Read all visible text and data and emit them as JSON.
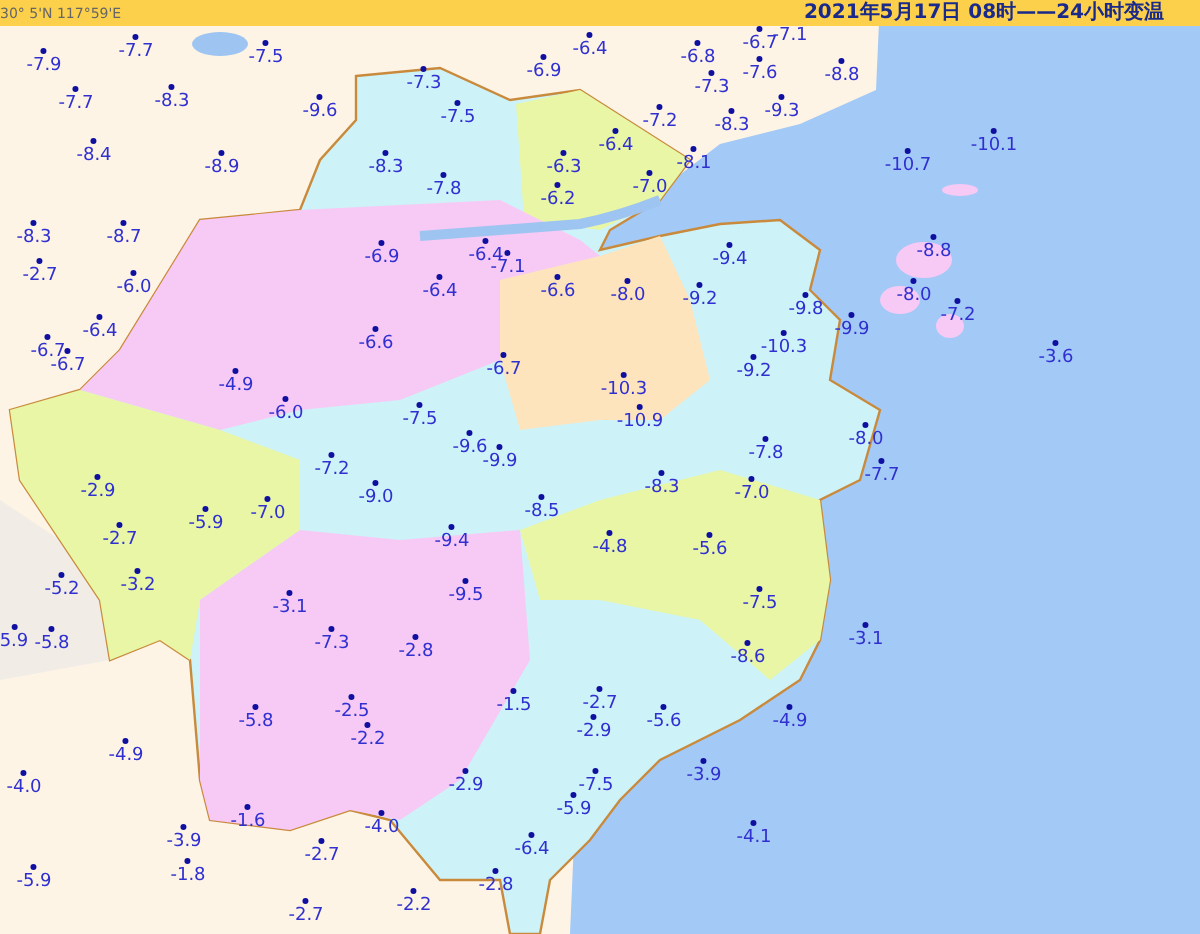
{
  "header": {
    "coordinates": "30° 5'N  117°59'E",
    "title": "2021年5月17日 08时——24小时变温"
  },
  "stations": [
    {
      "reading": "-7.9"
    },
    {
      "reading": "-7.7"
    },
    {
      "reading": "-7.5"
    },
    {
      "reading": "-7.7"
    },
    {
      "reading": "-8.3"
    },
    {
      "reading": "-9.6"
    },
    {
      "reading": "-8.4"
    },
    {
      "reading": "-8.9"
    },
    {
      "reading": "-8.3"
    },
    {
      "reading": "-8.3"
    },
    {
      "reading": "-8.7"
    },
    {
      "reading": "-6.9"
    },
    {
      "reading": "-2.7"
    },
    {
      "reading": "-6.0"
    },
    {
      "reading": "-6.4"
    },
    {
      "reading": "-6.6"
    },
    {
      "reading": "-6.7"
    },
    {
      "reading": "-6.7"
    },
    {
      "reading": "-4.9"
    },
    {
      "reading": "-6.0"
    },
    {
      "reading": "-6.4"
    },
    {
      "reading": "-6.9"
    },
    {
      "reading": "-7.3"
    },
    {
      "reading": "-6.8"
    },
    {
      "reading": "-6.7"
    },
    {
      "reading": "-7.1"
    },
    {
      "reading": "-7.6"
    },
    {
      "reading": "-7.3"
    },
    {
      "reading": "-7.5"
    },
    {
      "reading": "-7.2"
    },
    {
      "reading": "-8.3"
    },
    {
      "reading": "-9.3"
    },
    {
      "reading": "-6.4"
    },
    {
      "reading": "-6.3"
    },
    {
      "reading": "-8.1"
    },
    {
      "reading": "-7.0"
    },
    {
      "reading": "-7.8"
    },
    {
      "reading": "-6.2"
    },
    {
      "reading": "-6.4"
    },
    {
      "reading": "-7.1"
    },
    {
      "reading": "-9.4"
    },
    {
      "reading": "-6.4"
    },
    {
      "reading": "-6.6"
    },
    {
      "reading": "-8.0"
    },
    {
      "reading": "-9.2"
    },
    {
      "reading": "-10.3"
    },
    {
      "reading": "-6.7"
    },
    {
      "reading": "-9.2"
    },
    {
      "reading": "-10.3"
    },
    {
      "reading": "-7.5"
    },
    {
      "reading": "-10.9"
    },
    {
      "reading": "-9.6"
    },
    {
      "reading": "-9.9"
    },
    {
      "reading": "-7.8"
    },
    {
      "reading": "-8.8"
    },
    {
      "reading": "-10.1"
    },
    {
      "reading": "-10.7"
    },
    {
      "reading": "-8.8"
    },
    {
      "reading": "-9.8"
    },
    {
      "reading": "-8.0"
    },
    {
      "reading": "-7.2"
    },
    {
      "reading": "-9.9"
    },
    {
      "reading": "-3.6"
    },
    {
      "reading": "-8.0"
    },
    {
      "reading": "-7.2"
    },
    {
      "reading": "-2.9"
    },
    {
      "reading": "-9.0"
    },
    {
      "reading": "-5.9"
    },
    {
      "reading": "-7.0"
    },
    {
      "reading": "-2.7"
    },
    {
      "reading": "-3.2"
    },
    {
      "reading": "-5.2"
    },
    {
      "reading": "-3.1"
    },
    {
      "reading": "5.9"
    },
    {
      "reading": "-5.8"
    },
    {
      "reading": "-7.3"
    },
    {
      "reading": "-5.8"
    },
    {
      "reading": "-2.5"
    },
    {
      "reading": "-2.2"
    },
    {
      "reading": "-4.9"
    },
    {
      "reading": "-4.0"
    },
    {
      "reading": "-1.6"
    },
    {
      "reading": "-4.0"
    },
    {
      "reading": "-3.9"
    },
    {
      "reading": "-2.7"
    },
    {
      "reading": "-1.8"
    },
    {
      "reading": "-5.9"
    },
    {
      "reading": "-2.7"
    },
    {
      "reading": "-8.3"
    },
    {
      "reading": "-7.0"
    },
    {
      "reading": "-8.5"
    },
    {
      "reading": "-9.4"
    },
    {
      "reading": "-4.8"
    },
    {
      "reading": "-5.6"
    },
    {
      "reading": "-9.5"
    },
    {
      "reading": "-7.5"
    },
    {
      "reading": "-2.8"
    },
    {
      "reading": "-8.6"
    },
    {
      "reading": "-1.5"
    },
    {
      "reading": "-2.7"
    },
    {
      "reading": "-5.6"
    },
    {
      "reading": "-4.9"
    },
    {
      "reading": "-2.9"
    },
    {
      "reading": "-3.9"
    },
    {
      "reading": "-2.9"
    },
    {
      "reading": "-7.5"
    },
    {
      "reading": "-5.9"
    },
    {
      "reading": "-4.1"
    },
    {
      "reading": "-6.4"
    },
    {
      "reading": "-2.8"
    },
    {
      "reading": "-2.2"
    },
    {
      "reading": "-7.7"
    },
    {
      "reading": "-3.1"
    }
  ]
}
